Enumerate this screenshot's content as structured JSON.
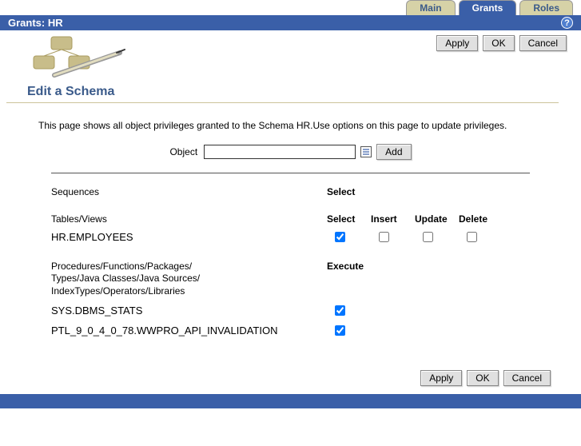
{
  "tabs": {
    "main": "Main",
    "grants": "Grants",
    "roles": "Roles"
  },
  "header": {
    "title": "Grants: HR"
  },
  "buttons": {
    "apply": "Apply",
    "ok": "OK",
    "cancel": "Cancel",
    "add": "Add"
  },
  "page": {
    "title": "Edit a Schema",
    "description": "This page shows all object privileges granted to the Schema HR.Use options on this page to update privileges."
  },
  "object": {
    "label": "Object",
    "value": ""
  },
  "sections": {
    "sequences": {
      "label": "Sequences",
      "cols": {
        "select": "Select"
      }
    },
    "tables": {
      "label": "Tables/Views",
      "cols": {
        "select": "Select",
        "insert": "Insert",
        "update": "Update",
        "delete": "Delete"
      },
      "rows": [
        {
          "name": "HR.EMPLOYEES",
          "select": true,
          "insert": false,
          "update": false,
          "delete": false
        }
      ]
    },
    "procs": {
      "label": "Procedures/Functions/Packages/\nTypes/Java Classes/Java Sources/\nIndexTypes/Operators/Libraries",
      "cols": {
        "execute": "Execute"
      },
      "rows": [
        {
          "name": "SYS.DBMS_STATS",
          "execute": true
        },
        {
          "name": "PTL_9_0_4_0_78.WWPRO_API_INVALIDATION",
          "execute": true
        }
      ]
    }
  }
}
